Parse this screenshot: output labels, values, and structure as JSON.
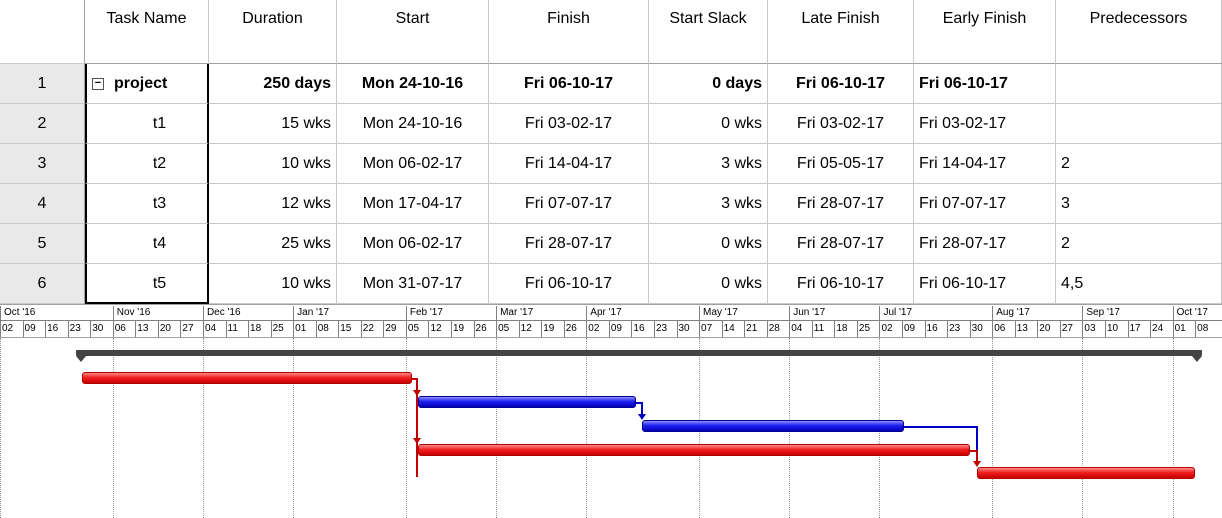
{
  "table": {
    "headers": {
      "task_name": "Task Name",
      "duration": "Duration",
      "start": "Start",
      "finish": "Finish",
      "start_slack": "Start Slack",
      "late_finish": "Late Finish",
      "early_finish": "Early Finish",
      "predecessors": "Predecessors"
    },
    "rows": [
      {
        "id": "1",
        "name": "project",
        "duration": "250 days",
        "start": "Mon 24-10-16",
        "finish": "Fri 06-10-17",
        "start_slack": "0 days",
        "late_finish": "Fri 06-10-17",
        "early_finish": "Fri 06-10-17",
        "predecessors": ""
      },
      {
        "id": "2",
        "name": "t1",
        "duration": "15 wks",
        "start": "Mon 24-10-16",
        "finish": "Fri 03-02-17",
        "start_slack": "0 wks",
        "late_finish": "Fri 03-02-17",
        "early_finish": "Fri 03-02-17",
        "predecessors": ""
      },
      {
        "id": "3",
        "name": "t2",
        "duration": "10 wks",
        "start": "Mon 06-02-17",
        "finish": "Fri 14-04-17",
        "start_slack": "3 wks",
        "late_finish": "Fri 05-05-17",
        "early_finish": "Fri 14-04-17",
        "predecessors": "2"
      },
      {
        "id": "4",
        "name": "t3",
        "duration": "12 wks",
        "start": "Mon 17-04-17",
        "finish": "Fri 07-07-17",
        "start_slack": "3 wks",
        "late_finish": "Fri 28-07-17",
        "early_finish": "Fri 07-07-17",
        "predecessors": "3"
      },
      {
        "id": "5",
        "name": "t4",
        "duration": "25 wks",
        "start": "Mon 06-02-17",
        "finish": "Fri 28-07-17",
        "start_slack": "0 wks",
        "late_finish": "Fri 28-07-17",
        "early_finish": "Fri 28-07-17",
        "predecessors": "2"
      },
      {
        "id": "6",
        "name": "t5",
        "duration": "10 wks",
        "start": "Mon 31-07-17",
        "finish": "Fri 06-10-17",
        "start_slack": "0 wks",
        "late_finish": "Fri 06-10-17",
        "early_finish": "Fri 06-10-17",
        "predecessors": "4,5"
      }
    ]
  },
  "summary_icon": "collapse-minus-icon",
  "timescale": {
    "months": [
      "Oct '16",
      "Nov '16",
      "Dec '16",
      "Jan '17",
      "Feb '17",
      "Mar '17",
      "Apr '17",
      "May '17",
      "Jun '17",
      "Jul '17",
      "Aug '17",
      "Sep '17",
      "Oct '17"
    ],
    "weeks": [
      "02",
      "09",
      "16",
      "23",
      "30",
      "06",
      "13",
      "20",
      "27",
      "04",
      "11",
      "18",
      "25",
      "01",
      "08",
      "15",
      "22",
      "29",
      "05",
      "12",
      "19",
      "26",
      "05",
      "12",
      "19",
      "26",
      "02",
      "09",
      "16",
      "23",
      "30",
      "07",
      "14",
      "21",
      "28",
      "04",
      "11",
      "18",
      "25",
      "02",
      "09",
      "16",
      "23",
      "30",
      "06",
      "13",
      "20",
      "27",
      "03",
      "10",
      "17",
      "24",
      "01",
      "08"
    ]
  },
  "gantt": {
    "colors": {
      "critical": "#e02020",
      "noncritical": "#1f1fe0",
      "summary": "#444444",
      "link_critical": "#c00000",
      "link_noncritical": "#0000c0"
    },
    "bars": [
      {
        "task": "t1",
        "critical": true
      },
      {
        "task": "t2",
        "critical": false
      },
      {
        "task": "t3",
        "critical": false
      },
      {
        "task": "t4",
        "critical": true
      },
      {
        "task": "t5",
        "critical": true
      }
    ]
  }
}
